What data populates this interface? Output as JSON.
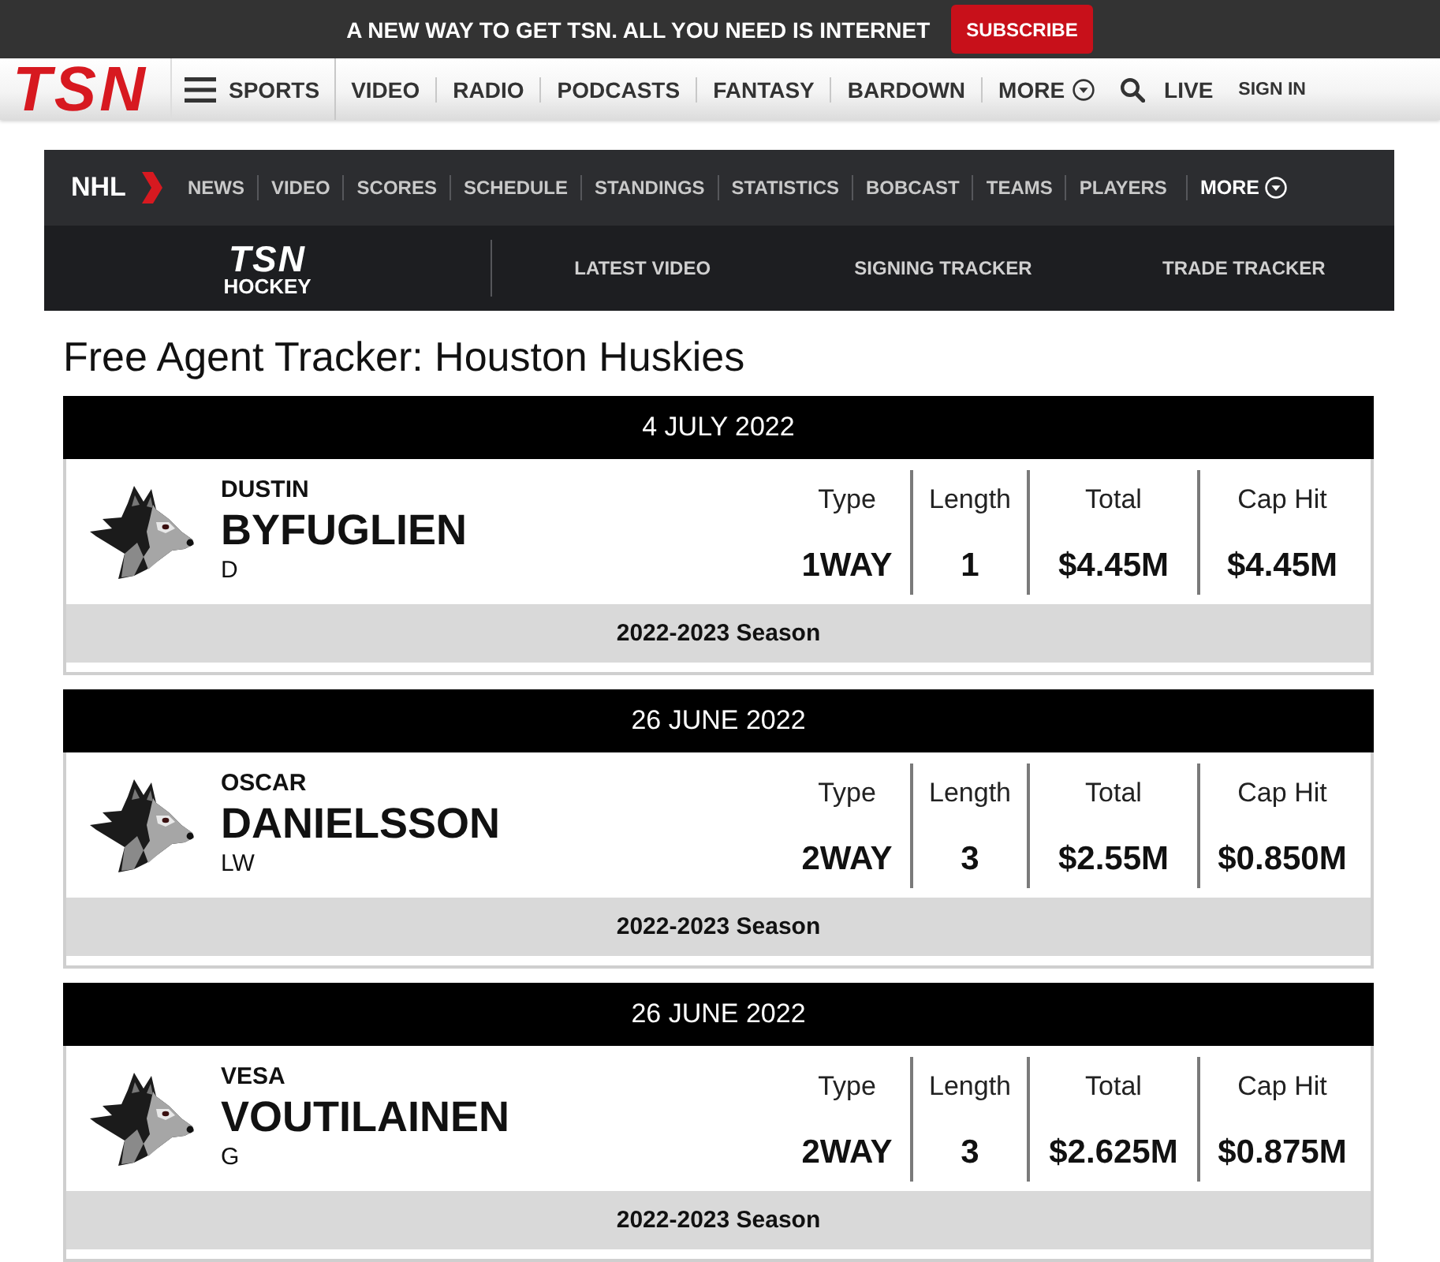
{
  "promo_banner": {
    "text": "A NEW WAY TO GET TSN. ALL YOU NEED IS INTERNET",
    "button": "SUBSCRIBE"
  },
  "site_nav": {
    "logo": "TSN",
    "items": [
      {
        "kind": "menu",
        "label": "SPORTS"
      },
      {
        "kind": "link",
        "label": "VIDEO"
      },
      {
        "kind": "link",
        "label": "RADIO"
      },
      {
        "kind": "link",
        "label": "PODCASTS"
      },
      {
        "kind": "link",
        "label": "FANTASY"
      },
      {
        "kind": "link",
        "label": "BARDOWN"
      },
      {
        "kind": "dropdown",
        "label": "MORE"
      },
      {
        "kind": "search"
      },
      {
        "kind": "live",
        "label": "LIVE"
      },
      {
        "kind": "account",
        "label": "SIGN IN"
      }
    ]
  },
  "section_nav": {
    "league": "NHL",
    "items": [
      {
        "kind": "link",
        "label": "NEWS"
      },
      {
        "kind": "link",
        "label": "VIDEO"
      },
      {
        "kind": "link",
        "label": "SCORES"
      },
      {
        "kind": "link",
        "label": "SCHEDULE"
      },
      {
        "kind": "link",
        "label": "STANDINGS"
      },
      {
        "kind": "link",
        "label": "STATISTICS"
      },
      {
        "kind": "link",
        "label": "BOBCAST"
      },
      {
        "kind": "link",
        "label": "TEAMS"
      },
      {
        "kind": "link",
        "label": "PLAYERS"
      },
      {
        "kind": "dropdown",
        "label": "MORE"
      }
    ],
    "logo": {
      "wordmark": "TSN",
      "section": "HOCKEY"
    },
    "links": [
      "LATEST VIDEO",
      "SIGNING TRACKER",
      "TRADE TRACKER"
    ]
  },
  "page_title": "Free Agent Tracker: Houston Huskies",
  "signings": [
    {
      "date": "4 JULY 2022",
      "first_name": "DUSTIN",
      "last_name": "BYFUGLIEN",
      "position": "D",
      "contract": [
        {
          "label": "Type",
          "value": "1WAY"
        },
        {
          "label": "Length",
          "value": "1"
        },
        {
          "label": "Total",
          "value": "$4.45M"
        },
        {
          "label": "Cap Hit",
          "value": "$4.45M"
        }
      ],
      "season": "2022-2023 Season"
    },
    {
      "date": "26 JUNE 2022",
      "first_name": "OSCAR",
      "last_name": "DANIELSSON",
      "position": "LW",
      "contract": [
        {
          "label": "Type",
          "value": "2WAY"
        },
        {
          "label": "Length",
          "value": "3"
        },
        {
          "label": "Total",
          "value": "$2.55M"
        },
        {
          "label": "Cap Hit",
          "value": "$0.850M"
        }
      ],
      "season": "2022-2023 Season"
    },
    {
      "date": "26 JUNE 2022",
      "first_name": "VESA",
      "last_name": "VOUTILAINEN",
      "position": "G",
      "contract": [
        {
          "label": "Type",
          "value": "2WAY"
        },
        {
          "label": "Length",
          "value": "3"
        },
        {
          "label": "Total",
          "value": "$2.625M"
        },
        {
          "label": "Cap Hit",
          "value": "$0.875M"
        }
      ],
      "season": "2022-2023 Season"
    }
  ]
}
